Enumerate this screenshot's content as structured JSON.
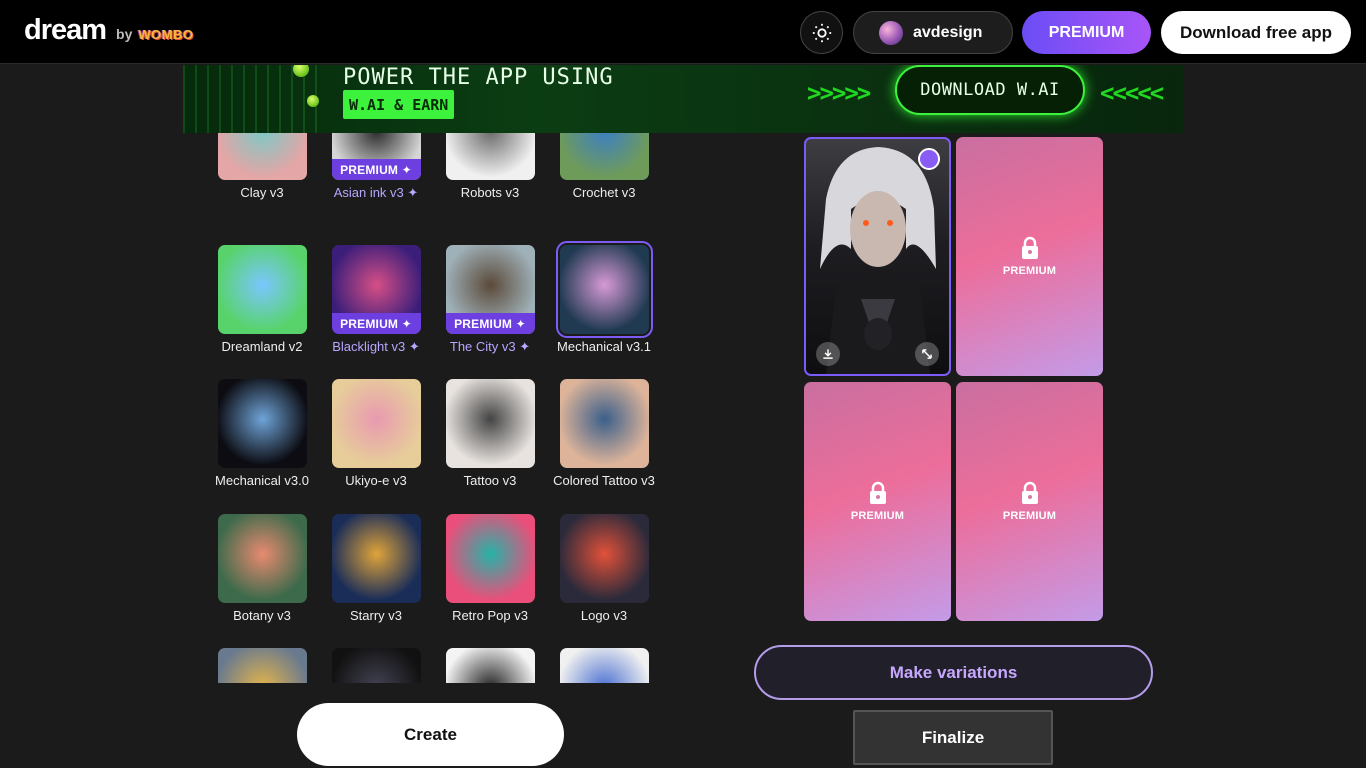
{
  "header": {
    "logo_main": "dream",
    "logo_by": "by",
    "logo_brand": "WOMBO",
    "theme_icon": "sun-icon",
    "username": "avdesign",
    "premium_label": "PREMIUM",
    "download_label": "Download free app"
  },
  "banner": {
    "title": "POWER THE APP USING",
    "tag": "W.AI & EARN",
    "cta": "DOWNLOAD W.AI",
    "arrows_left": ">>>>>",
    "arrows_right": "<<<<<"
  },
  "styles": [
    {
      "label": "Clay v3",
      "premium": false,
      "tag": "",
      "colors": [
        "#e4a6a6",
        "#7ec8c5"
      ]
    },
    {
      "label": "Asian ink v3 ✦",
      "premium": true,
      "tag": "PREMIUM ✦",
      "colors": [
        "#d6d6d6",
        "#2b2b2b"
      ]
    },
    {
      "label": "Robots v3",
      "premium": false,
      "tag": "",
      "colors": [
        "#f0f0f0",
        "#6a6a6a"
      ]
    },
    {
      "label": "Crochet v3",
      "premium": false,
      "tag": "",
      "colors": [
        "#6f9b5a",
        "#3d7fc2"
      ]
    },
    {
      "label": "Dreamland v2",
      "premium": false,
      "tag": "",
      "colors": [
        "#58d36b",
        "#7ac6ff"
      ]
    },
    {
      "label": "Blacklight v3 ✦",
      "premium": true,
      "tag": "PREMIUM ✦",
      "colors": [
        "#3b1e7a",
        "#d64f86"
      ]
    },
    {
      "label": "The City v3 ✦",
      "premium": true,
      "tag": "PREMIUM ✦",
      "colors": [
        "#9fb1b8",
        "#5b4a3a"
      ]
    },
    {
      "label": "Mechanical v3.1",
      "premium": false,
      "tag": "",
      "selected": true,
      "colors": [
        "#203a52",
        "#d79ad6"
      ]
    },
    {
      "label": "Mechanical v3.0",
      "premium": false,
      "tag": "",
      "colors": [
        "#0c0c12",
        "#6fa4d8"
      ]
    },
    {
      "label": "Ukiyo-e v3",
      "premium": false,
      "tag": "",
      "colors": [
        "#e7cd9a",
        "#e89ab0"
      ]
    },
    {
      "label": "Tattoo v3",
      "premium": false,
      "tag": "",
      "colors": [
        "#e8e3df",
        "#444"
      ]
    },
    {
      "label": "Colored Tattoo v3",
      "premium": false,
      "tag": "",
      "colors": [
        "#ddb49a",
        "#3b5f8a"
      ]
    },
    {
      "label": "Botany v3",
      "premium": false,
      "tag": "",
      "colors": [
        "#3d6a4b",
        "#e88a70"
      ]
    },
    {
      "label": "Starry v3",
      "premium": false,
      "tag": "",
      "colors": [
        "#1a2d58",
        "#e0a43a"
      ]
    },
    {
      "label": "Retro Pop v3",
      "premium": false,
      "tag": "",
      "colors": [
        "#e94f7a",
        "#26b3a8"
      ]
    },
    {
      "label": "Logo v3",
      "premium": false,
      "tag": "",
      "colors": [
        "#2b2a3a",
        "#e2513a"
      ]
    },
    {
      "label": "",
      "premium": false,
      "tag": "",
      "colors": [
        "#6a7a8e",
        "#e5b54a"
      ]
    },
    {
      "label": "",
      "premium": false,
      "tag": "",
      "colors": [
        "#111",
        "#445"
      ]
    },
    {
      "label": "",
      "premium": false,
      "tag": "",
      "colors": [
        "#f4f4f4",
        "#222"
      ]
    },
    {
      "label": "",
      "premium": false,
      "tag": "",
      "colors": [
        "#f0f0f0",
        "#4a6fd1"
      ]
    }
  ],
  "results": {
    "locked_label": "PREMIUM",
    "download_icon": "download-icon",
    "expand_icon": "expand-icon",
    "lock_icon": "lock-icon"
  },
  "actions": {
    "variations": "Make variations",
    "finalize": "Finalize",
    "create": "Create"
  }
}
